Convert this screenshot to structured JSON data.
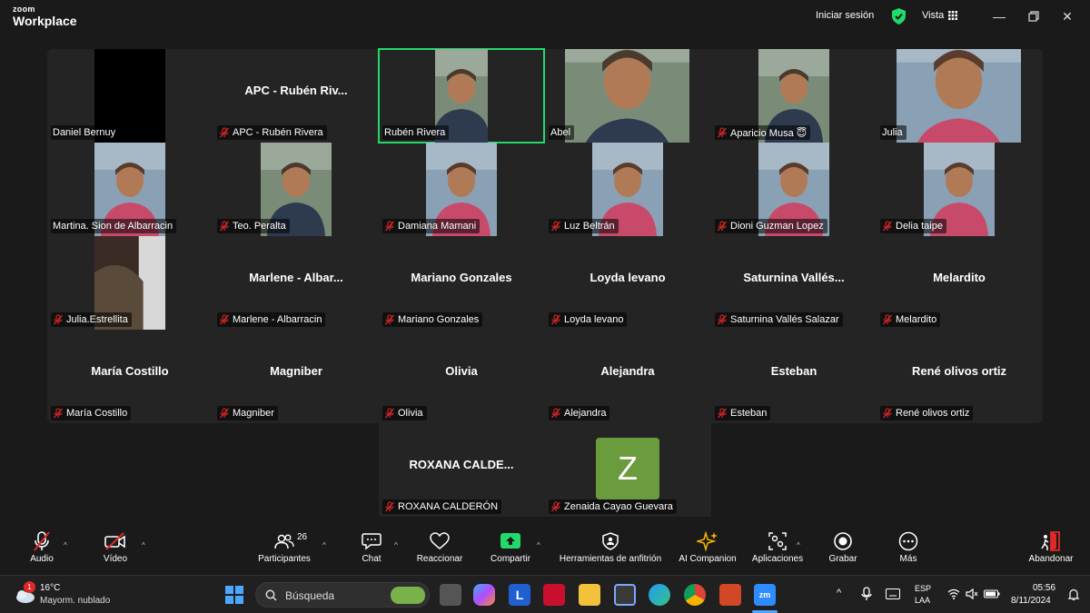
{
  "app": {
    "logo_top": "zoom",
    "logo_bottom": "Workplace"
  },
  "header": {
    "signin": "Iniciar sesión",
    "view": "Vista"
  },
  "colors": {
    "active_speaker": "#23d96b",
    "avatar_z": "#6a9b3c",
    "muted_mic": "#e02828"
  },
  "participants": [
    {
      "name": "Daniel Bernuy",
      "muted": false,
      "video": "black"
    },
    {
      "big": "APC - Rubén Riv...",
      "name": "APC - Rubén Rivera",
      "muted": true
    },
    {
      "name": "Rubén Rivera",
      "muted": false,
      "video": "man",
      "active": true
    },
    {
      "name": "Abel",
      "muted": false,
      "video": "man"
    },
    {
      "name": "Aparicio Musa 😇",
      "muted": true,
      "video": "man"
    },
    {
      "name": "Julia",
      "muted": false,
      "video": "woman"
    },
    {
      "name": "Martina. Sion de Albarracin",
      "muted": false,
      "video": "woman"
    },
    {
      "name": "Teo. Peralta",
      "muted": true,
      "video": "man"
    },
    {
      "name": "Damiana Mamani",
      "muted": true,
      "video": "woman"
    },
    {
      "name": "Luz Beltrán",
      "muted": true,
      "video": "woman"
    },
    {
      "name": "Dioni Guzman Lopez",
      "muted": true,
      "video": "woman"
    },
    {
      "name": "Delia taipe",
      "muted": true,
      "video": "woman"
    },
    {
      "name": "Julia.Estrellita",
      "muted": true,
      "video": "dark"
    },
    {
      "big": "Marlene - Albar...",
      "name": "Marlene - Albarracin",
      "muted": true
    },
    {
      "big": "Mariano Gonzales",
      "name": "Mariano Gonzales",
      "muted": true
    },
    {
      "big": "Loyda levano",
      "name": "Loyda levano",
      "muted": true
    },
    {
      "big": "Saturnina Vallés...",
      "name": "Saturnina Vallés Salazar",
      "muted": true
    },
    {
      "big": "Melardito",
      "name": "Melardito",
      "muted": true
    },
    {
      "big": "María Costillo",
      "name": "María Costillo",
      "muted": true
    },
    {
      "big": "Magniber",
      "name": "Magniber",
      "muted": true
    },
    {
      "big": "Olivia",
      "name": "Olivia",
      "muted": true
    },
    {
      "big": "Alejandra",
      "name": "Alejandra",
      "muted": true
    },
    {
      "big": "Esteban",
      "name": "Esteban",
      "muted": true
    },
    {
      "big": "René olivos ortiz",
      "name": "René olivos ortiz",
      "muted": true
    },
    {
      "big": "ROXANA CALDE...",
      "name": "ROXANA CALDERÓN",
      "muted": true
    },
    {
      "avatar": "Z",
      "name": "Zenaida Cayao Guevara",
      "muted": true
    }
  ],
  "toolbar": {
    "audio": "Audio",
    "video": "Vídeo",
    "participants": "Participantes",
    "participants_count": "26",
    "chat": "Chat",
    "react": "Reaccionar",
    "share": "Compartir",
    "host_tools": "Herramientas de anfitrión",
    "ai": "AI Companion",
    "apps": "Aplicaciones",
    "record": "Grabar",
    "more": "Más",
    "leave": "Abandonar"
  },
  "taskbar": {
    "weather_badge": "1",
    "temp": "16°C",
    "weather_desc": "Mayorm. nublado",
    "search": "Búsqueda",
    "lang1": "ESP",
    "lang2": "LAA",
    "time": "05:56",
    "date": "8/11/2024"
  }
}
